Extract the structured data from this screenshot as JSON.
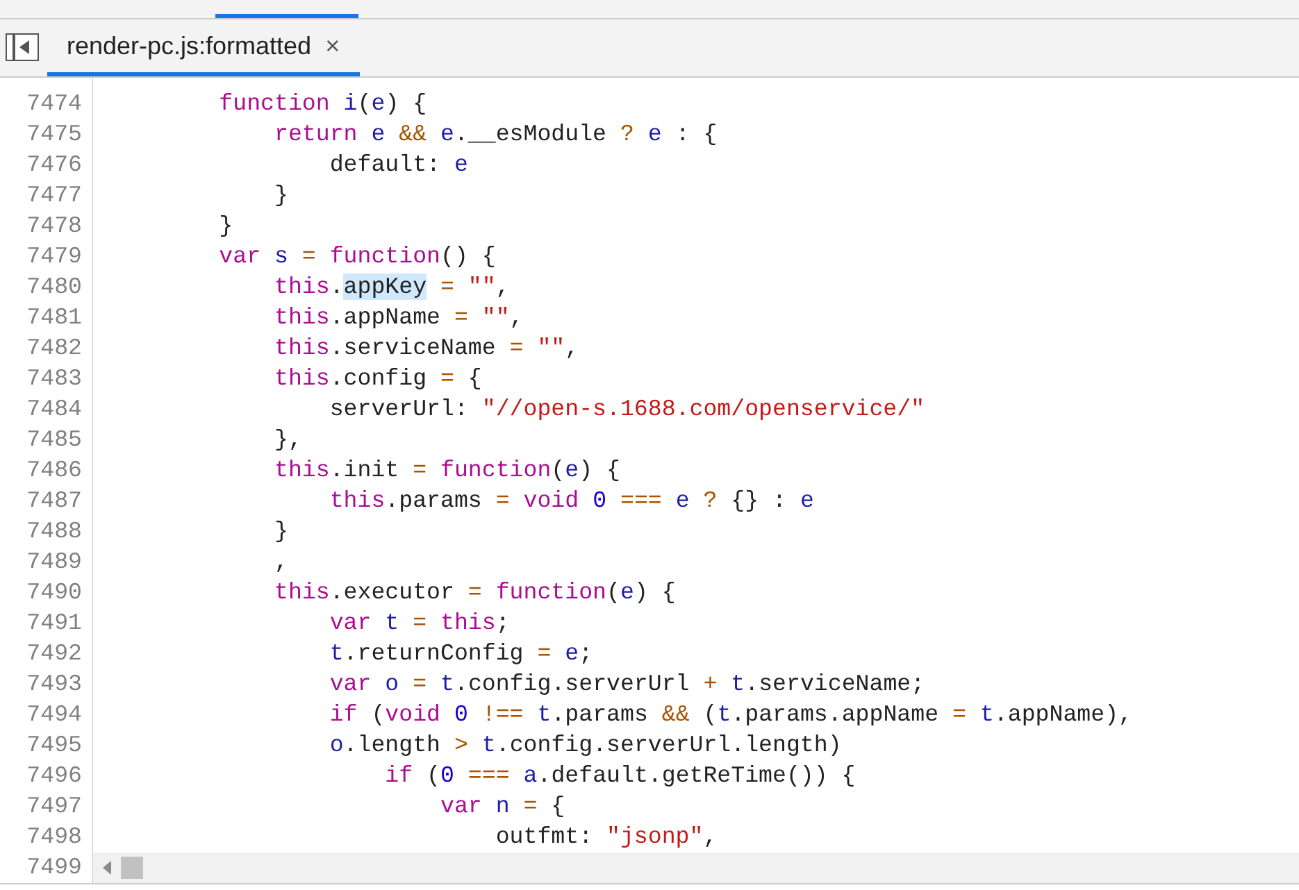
{
  "tab": {
    "label": "render-pc.js:formatted",
    "close": "×",
    "selected": true
  },
  "editor": {
    "lines": [
      {
        "number": "7474",
        "tokens": [
          {
            "text": "        function ",
            "kind": "keyword"
          },
          {
            "text": "i",
            "kind": "variable"
          },
          {
            "text": "(",
            "kind": "plain"
          },
          {
            "text": "e",
            "kind": "variable"
          },
          {
            "text": ") {",
            "kind": "plain"
          }
        ]
      },
      {
        "number": "7475",
        "tokens": [
          {
            "text": "            return ",
            "kind": "keyword"
          },
          {
            "text": "e ",
            "kind": "variable"
          },
          {
            "text": "&& ",
            "kind": "operator"
          },
          {
            "text": "e",
            "kind": "variable"
          },
          {
            "text": ".__esModule ",
            "kind": "plain"
          },
          {
            "text": "? ",
            "kind": "operator"
          },
          {
            "text": "e",
            "kind": "variable"
          },
          {
            "text": " : {",
            "kind": "plain"
          }
        ]
      },
      {
        "number": "7476",
        "tokens": [
          {
            "text": "                default: ",
            "kind": "plain"
          },
          {
            "text": "e",
            "kind": "variable"
          }
        ]
      },
      {
        "number": "7477",
        "tokens": [
          {
            "text": "            }",
            "kind": "plain"
          }
        ]
      },
      {
        "number": "7478",
        "tokens": [
          {
            "text": "        }",
            "kind": "plain"
          }
        ]
      },
      {
        "number": "7479",
        "tokens": [
          {
            "text": "        var ",
            "kind": "keyword"
          },
          {
            "text": "s ",
            "kind": "variable"
          },
          {
            "text": "= ",
            "kind": "operator"
          },
          {
            "text": "function",
            "kind": "keyword"
          },
          {
            "text": "() {",
            "kind": "plain"
          }
        ]
      },
      {
        "number": "7480",
        "tokens": [
          {
            "text": "            this",
            "kind": "keyword"
          },
          {
            "text": ".",
            "kind": "plain"
          },
          {
            "text": "appKey",
            "kind": "selection"
          },
          {
            "text": " = ",
            "kind": "operator"
          },
          {
            "text": "\"\"",
            "kind": "string"
          },
          {
            "text": ",",
            "kind": "plain"
          }
        ]
      },
      {
        "number": "7481",
        "tokens": [
          {
            "text": "            this",
            "kind": "keyword"
          },
          {
            "text": ".appName ",
            "kind": "plain"
          },
          {
            "text": "= ",
            "kind": "operator"
          },
          {
            "text": "\"\"",
            "kind": "string"
          },
          {
            "text": ",",
            "kind": "plain"
          }
        ]
      },
      {
        "number": "7482",
        "tokens": [
          {
            "text": "            this",
            "kind": "keyword"
          },
          {
            "text": ".serviceName ",
            "kind": "plain"
          },
          {
            "text": "= ",
            "kind": "operator"
          },
          {
            "text": "\"\"",
            "kind": "string"
          },
          {
            "text": ",",
            "kind": "plain"
          }
        ]
      },
      {
        "number": "7483",
        "tokens": [
          {
            "text": "            this",
            "kind": "keyword"
          },
          {
            "text": ".config ",
            "kind": "plain"
          },
          {
            "text": "=",
            "kind": "operator"
          },
          {
            "text": " {",
            "kind": "plain"
          }
        ]
      },
      {
        "number": "7484",
        "tokens": [
          {
            "text": "                serverUrl: ",
            "kind": "plain"
          },
          {
            "text": "\"//open-s.1688.com/openservice/\"",
            "kind": "string"
          }
        ]
      },
      {
        "number": "7485",
        "tokens": [
          {
            "text": "            },",
            "kind": "plain"
          }
        ]
      },
      {
        "number": "7486",
        "tokens": [
          {
            "text": "            this",
            "kind": "keyword"
          },
          {
            "text": ".init ",
            "kind": "plain"
          },
          {
            "text": "= ",
            "kind": "operator"
          },
          {
            "text": "function",
            "kind": "keyword"
          },
          {
            "text": "(",
            "kind": "plain"
          },
          {
            "text": "e",
            "kind": "variable"
          },
          {
            "text": ") {",
            "kind": "plain"
          }
        ]
      },
      {
        "number": "7487",
        "tokens": [
          {
            "text": "                this",
            "kind": "keyword"
          },
          {
            "text": ".params ",
            "kind": "plain"
          },
          {
            "text": "= ",
            "kind": "operator"
          },
          {
            "text": "void ",
            "kind": "keyword"
          },
          {
            "text": "0 ",
            "kind": "number"
          },
          {
            "text": "=== ",
            "kind": "operator"
          },
          {
            "text": "e ",
            "kind": "variable"
          },
          {
            "text": "?",
            "kind": "operator"
          },
          {
            "text": " {} : ",
            "kind": "plain"
          },
          {
            "text": "e",
            "kind": "variable"
          }
        ]
      },
      {
        "number": "7488",
        "tokens": [
          {
            "text": "            }",
            "kind": "plain"
          }
        ]
      },
      {
        "number": "7489",
        "tokens": [
          {
            "text": "            ,",
            "kind": "plain"
          }
        ]
      },
      {
        "number": "7490",
        "tokens": [
          {
            "text": "            this",
            "kind": "keyword"
          },
          {
            "text": ".executor ",
            "kind": "plain"
          },
          {
            "text": "= ",
            "kind": "operator"
          },
          {
            "text": "function",
            "kind": "keyword"
          },
          {
            "text": "(",
            "kind": "plain"
          },
          {
            "text": "e",
            "kind": "variable"
          },
          {
            "text": ") {",
            "kind": "plain"
          }
        ]
      },
      {
        "number": "7491",
        "tokens": [
          {
            "text": "                var ",
            "kind": "keyword"
          },
          {
            "text": "t ",
            "kind": "variable"
          },
          {
            "text": "= ",
            "kind": "operator"
          },
          {
            "text": "this",
            "kind": "keyword"
          },
          {
            "text": ";",
            "kind": "plain"
          }
        ]
      },
      {
        "number": "7492",
        "tokens": [
          {
            "text": "                t",
            "kind": "variable"
          },
          {
            "text": ".returnConfig ",
            "kind": "plain"
          },
          {
            "text": "= ",
            "kind": "operator"
          },
          {
            "text": "e",
            "kind": "variable"
          },
          {
            "text": ";",
            "kind": "plain"
          }
        ]
      },
      {
        "number": "7493",
        "tokens": [
          {
            "text": "                var ",
            "kind": "keyword"
          },
          {
            "text": "o ",
            "kind": "variable"
          },
          {
            "text": "= ",
            "kind": "operator"
          },
          {
            "text": "t",
            "kind": "variable"
          },
          {
            "text": ".config.serverUrl ",
            "kind": "plain"
          },
          {
            "text": "+ ",
            "kind": "operator"
          },
          {
            "text": "t",
            "kind": "variable"
          },
          {
            "text": ".serviceName;",
            "kind": "plain"
          }
        ]
      },
      {
        "number": "7494",
        "tokens": [
          {
            "text": "                if",
            "kind": "keyword"
          },
          {
            "text": " (",
            "kind": "plain"
          },
          {
            "text": "void ",
            "kind": "keyword"
          },
          {
            "text": "0 ",
            "kind": "number"
          },
          {
            "text": "!== ",
            "kind": "operator"
          },
          {
            "text": "t",
            "kind": "variable"
          },
          {
            "text": ".params ",
            "kind": "plain"
          },
          {
            "text": "&&",
            "kind": "operator"
          },
          {
            "text": " (",
            "kind": "plain"
          },
          {
            "text": "t",
            "kind": "variable"
          },
          {
            "text": ".params.appName ",
            "kind": "plain"
          },
          {
            "text": "= ",
            "kind": "operator"
          },
          {
            "text": "t",
            "kind": "variable"
          },
          {
            "text": ".appName),",
            "kind": "plain"
          }
        ]
      },
      {
        "number": "7495",
        "tokens": [
          {
            "text": "                o",
            "kind": "variable"
          },
          {
            "text": ".length ",
            "kind": "plain"
          },
          {
            "text": "> ",
            "kind": "operator"
          },
          {
            "text": "t",
            "kind": "variable"
          },
          {
            "text": ".config.serverUrl.length)",
            "kind": "plain"
          }
        ]
      },
      {
        "number": "7496",
        "tokens": [
          {
            "text": "                    if",
            "kind": "keyword"
          },
          {
            "text": " (",
            "kind": "plain"
          },
          {
            "text": "0 ",
            "kind": "number"
          },
          {
            "text": "=== ",
            "kind": "operator"
          },
          {
            "text": "a",
            "kind": "variable"
          },
          {
            "text": ".default.getReTime()) {",
            "kind": "plain"
          }
        ]
      },
      {
        "number": "7497",
        "tokens": [
          {
            "text": "                        var ",
            "kind": "keyword"
          },
          {
            "text": "n ",
            "kind": "variable"
          },
          {
            "text": "=",
            "kind": "operator"
          },
          {
            "text": " {",
            "kind": "plain"
          }
        ]
      },
      {
        "number": "7498",
        "tokens": [
          {
            "text": "                            outfmt: ",
            "kind": "plain"
          },
          {
            "text": "\"jsonp\"",
            "kind": "string"
          },
          {
            "text": ",",
            "kind": "plain"
          }
        ]
      }
    ],
    "last_line_number": "7499"
  }
}
